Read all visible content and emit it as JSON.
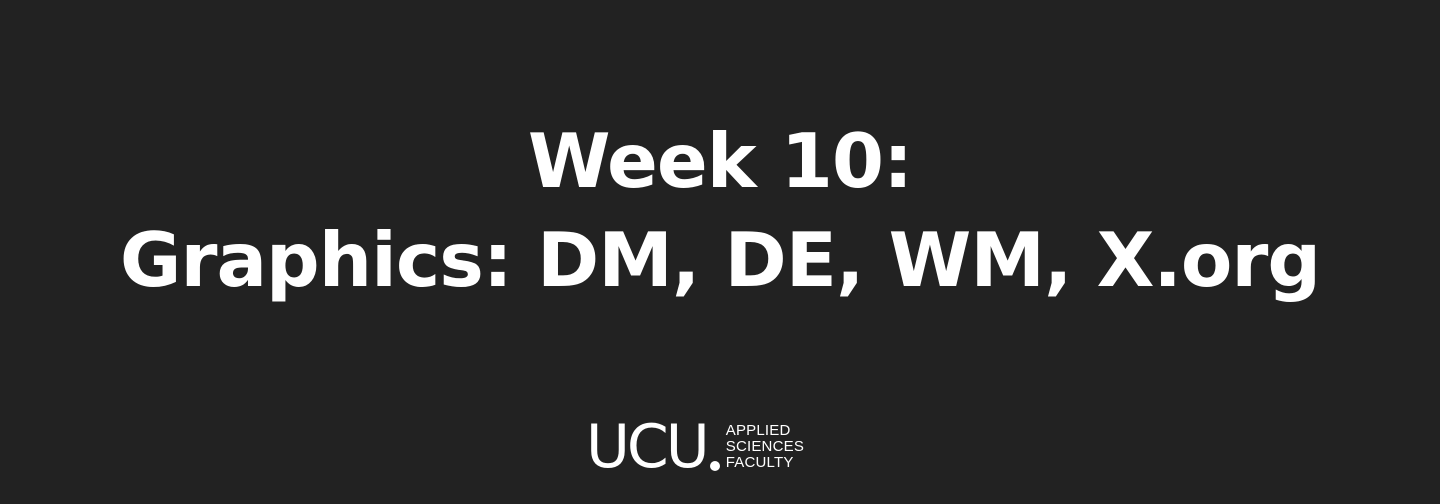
{
  "slide": {
    "background": "#222222",
    "text_color": "#ffffff",
    "title_lines": [
      "Week 10:",
      "Graphics: DM, DE, WM, X.org"
    ]
  },
  "logo": {
    "mark": "UCU",
    "faculty_lines": [
      "APPLIED",
      "SCIENCES",
      "FACULTY"
    ]
  }
}
